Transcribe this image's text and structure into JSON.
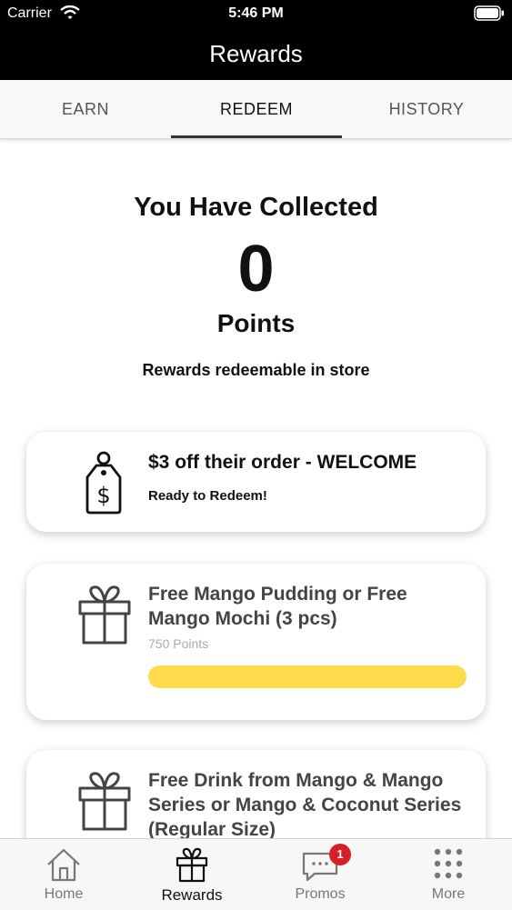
{
  "status_bar": {
    "carrier": "Carrier",
    "time": "5:46 PM"
  },
  "nav": {
    "title": "Rewards"
  },
  "tabs": [
    {
      "label": "EARN",
      "active": false
    },
    {
      "label": "REDEEM",
      "active": true
    },
    {
      "label": "HISTORY",
      "active": false
    }
  ],
  "summary": {
    "heading": "You Have Collected",
    "points": "0",
    "unit": "Points",
    "note": "Rewards redeemable in store"
  },
  "rewards": [
    {
      "title": "$3 off their order - WELCOME",
      "status": "Ready to Redeem!",
      "icon": "price-tag-icon"
    },
    {
      "title": "Free Mango Pudding or Free Mango Mochi (3 pcs)",
      "points": "750 Points",
      "progress": 1.0,
      "icon": "gift-icon"
    },
    {
      "title": "Free Drink from Mango & Mango Series or Mango & Coconut Series (Regular Size)",
      "icon": "gift-icon"
    }
  ],
  "tab_bar": {
    "items": [
      {
        "label": "Home",
        "icon": "home-icon"
      },
      {
        "label": "Rewards",
        "icon": "gift-icon",
        "active": true
      },
      {
        "label": "Promos",
        "icon": "chat-icon",
        "badge": "1"
      },
      {
        "label": "More",
        "icon": "grid-dots-icon"
      }
    ]
  },
  "colors": {
    "accent": "#FDDB4A",
    "badge": "#D81F26",
    "bar": "#000000",
    "text_dark": "#111111"
  }
}
